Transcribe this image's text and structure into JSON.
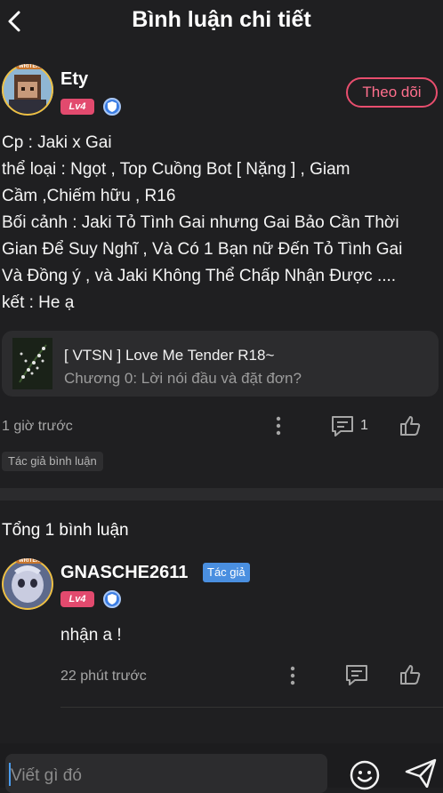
{
  "header": {
    "title": "Bình luận chi tiết",
    "back_icon": "chevron-left-icon"
  },
  "post": {
    "author": "Ety",
    "level": "Lv4",
    "writer_badge": "WRITER",
    "follow_label": "Theo dõi",
    "lines": [
      "Cp : Jaki x Gai",
      "thể loại : Ngọt ,  Top Cuồng Bot [ Nặng ] , Giam",
      "Cầm ,Chiếm hữu , R16",
      "Bối cảnh :  Jaki Tỏ Tình Gai nhưng  Gai Bảo Cần Thời",
      "Gian Để Suy Nghĩ , Và Có 1 Bạn nữ Đến Tỏ Tình Gai",
      "Và Đồng ý  ,  và Jaki Không Thể Chấp Nhận Được ....",
      "kết : He ạ"
    ],
    "chapter": {
      "title": "[ VTSN ] Love Me Tender R18~",
      "subtitle": "Chương 0: Lời nói đầu và đặt đơn?"
    },
    "time": "1 giờ trước",
    "comment_count": "1",
    "tag": "Tác giả bình luận"
  },
  "comments": {
    "total_label": "Tổng 1 bình luận",
    "items": [
      {
        "author": "GNASCHE2611",
        "author_tag": "Tác giả",
        "level": "Lv4",
        "writer_badge": "WRITER",
        "text": "nhận a !",
        "time": "22 phút trước"
      }
    ]
  },
  "input": {
    "placeholder": "Viết gì đó"
  },
  "colors": {
    "background": "#1f1f21",
    "accent_pink": "#e84e6e",
    "level_badge": "#e24a6e",
    "author_tag": "#4a8fe0"
  }
}
